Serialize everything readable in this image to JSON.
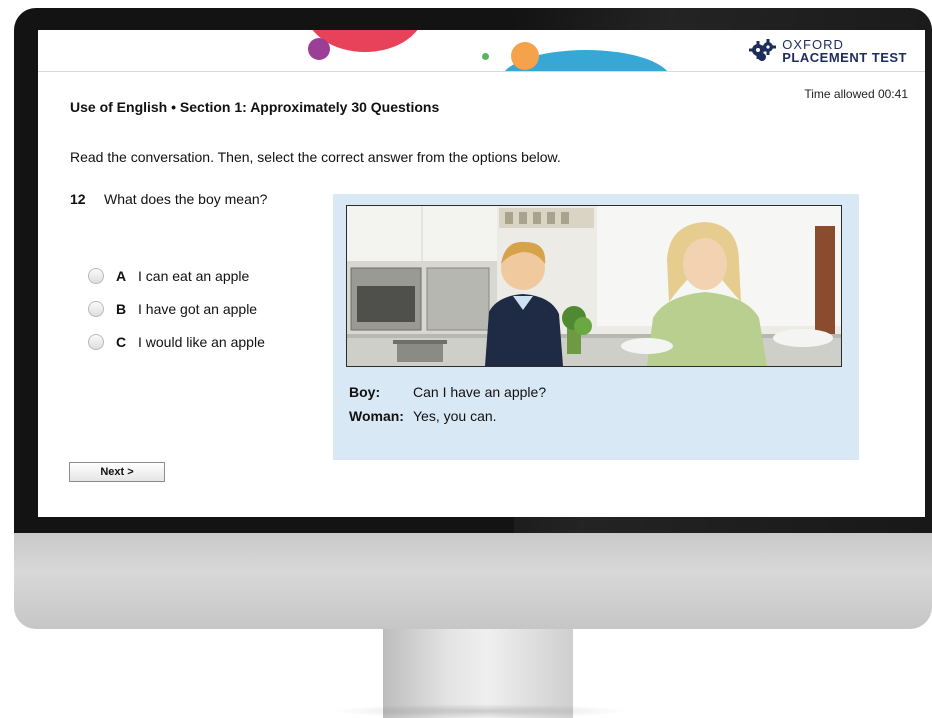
{
  "logo": {
    "line1": "OXFORD",
    "line2": "PLACEMENT TEST",
    "icon": "gear-cluster-logo-icon"
  },
  "timer": "Time allowed 00:41",
  "section_title": "Use of English • Section 1: Approximately 30 Questions",
  "instruction": "Read the conversation. Then, select the correct answer from the options below.",
  "question": {
    "number": "12",
    "text": "What does the boy mean?"
  },
  "options": [
    {
      "letter": "A",
      "text": "I can eat an apple",
      "selected": false
    },
    {
      "letter": "B",
      "text": "I have got an apple",
      "selected": false
    },
    {
      "letter": "C",
      "text": "I would like an apple",
      "selected": false
    }
  ],
  "dialogue": [
    {
      "speaker": "Boy:",
      "line": "Can I have an apple?"
    },
    {
      "speaker": "Woman:",
      "line": "Yes, you can."
    }
  ],
  "next_button": "Next >",
  "colors": {
    "panel": "#d9e8f5",
    "logo": "#1e2d5c",
    "deco_red": "#e8425a",
    "deco_blue": "#37a8d6",
    "deco_orange": "#f5a24b",
    "deco_purple": "#9b3f96",
    "deco_green": "#55b65d"
  }
}
